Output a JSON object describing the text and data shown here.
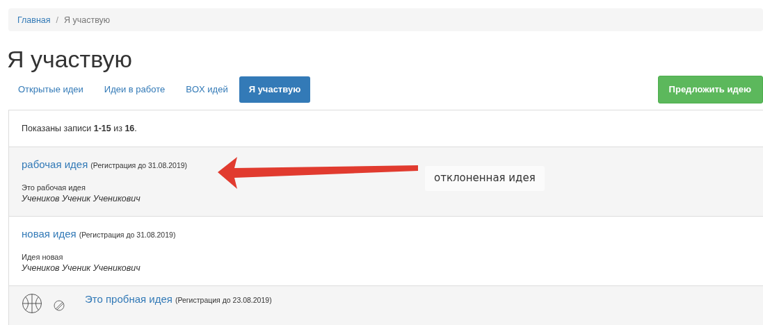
{
  "breadcrumb": [
    {
      "label": "Главная",
      "kind": "link"
    },
    {
      "label": "/",
      "kind": "separator"
    },
    {
      "label": "Я участвую",
      "kind": "current"
    }
  ],
  "title": "Я участвую",
  "tabs": [
    {
      "label": "Открытые идеи",
      "selected": false
    },
    {
      "label": "Идеи в работе",
      "selected": false
    },
    {
      "label": "BOX идей",
      "selected": false
    },
    {
      "label": "Я участвую",
      "selected": true
    }
  ],
  "propose_button": "Предложить идею",
  "summary": "Показаны записи **1-15** из **16**.",
  "ideas": [
    {
      "kind": "plain",
      "title": "рабочая идея",
      "deadline": "(Регистрация до 31.08.2019)",
      "description": "Это рабочая идея",
      "author": "Учеников Ученик Ученикович"
    },
    {
      "kind": "plain",
      "title": "новая идея",
      "deadline": "(Регистрация до 31.08.2019)",
      "description": "Идея новая",
      "author": "Учеников Ученик Ученикович"
    },
    {
      "kind": "with-icons",
      "title": "Это пробная идея",
      "deadline": "(Регистрация до 23.08.2019)"
    }
  ],
  "annotation": {
    "text": "отклоненная идея"
  }
}
